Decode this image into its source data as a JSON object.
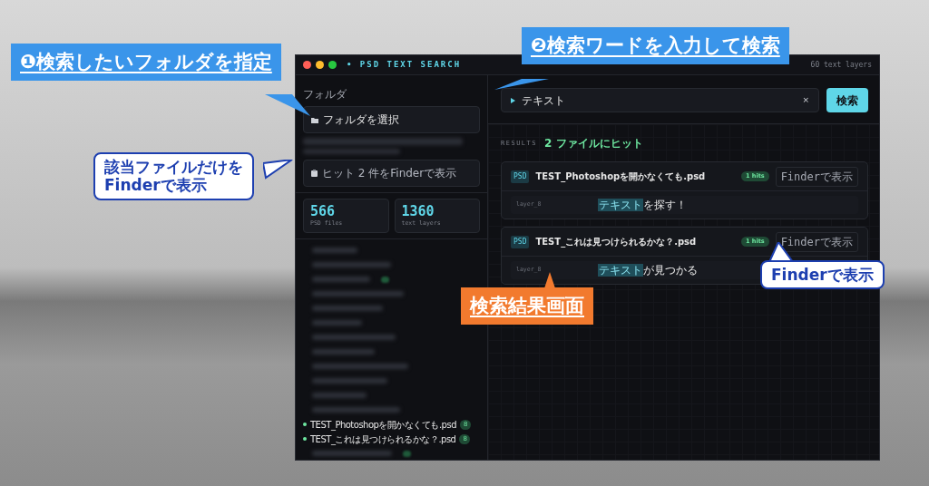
{
  "window": {
    "title": "• PSD TEXT SEARCH",
    "header_info": "60 text layers"
  },
  "sidebar": {
    "folder_label": "フォルダ",
    "folder_button": "フォルダを選択",
    "finder_button": "ヒット 2 件をFinderで表示",
    "stats": [
      {
        "value": "566",
        "label": "PSD files"
      },
      {
        "value": "1360",
        "label": "text layers"
      }
    ],
    "files": [
      {
        "kind": "blurred",
        "badge": false
      },
      {
        "kind": "blurred",
        "badge": false
      },
      {
        "kind": "blurred",
        "badge": true
      },
      {
        "kind": "blurred",
        "badge": false
      },
      {
        "kind": "blurred",
        "badge": false
      },
      {
        "kind": "blurred",
        "badge": false
      },
      {
        "kind": "blurred",
        "badge": false
      },
      {
        "kind": "blurred",
        "badge": false
      },
      {
        "kind": "blurred",
        "badge": false
      },
      {
        "kind": "blurred",
        "badge": false
      },
      {
        "kind": "blurred",
        "badge": false
      },
      {
        "kind": "blurred",
        "badge": false
      },
      {
        "kind": "file",
        "name": "TEST_Photoshopを開かなくても.psd",
        "count": "8"
      },
      {
        "kind": "file",
        "name": "TEST_これは見つけられるかな？.psd",
        "count": "8"
      },
      {
        "kind": "blurred",
        "badge": true
      }
    ]
  },
  "search": {
    "value": "テキスト",
    "clear": "×",
    "button": "検索"
  },
  "results": {
    "label": "RESULTS",
    "summary": "2 ファイルにヒット",
    "files": [
      {
        "tag": "PSD",
        "name": "TEST_Photoshopを開かなくても.psd",
        "hits": "1 hits",
        "finder_button": "Finderで表示",
        "matches": [
          {
            "layer": "layer_8",
            "highlight": "テキスト",
            "rest": "を探す！"
          }
        ]
      },
      {
        "tag": "PSD",
        "name": "TEST_これは見つけられるかな？.psd",
        "hits": "1 hits",
        "finder_button": "Finderで表示",
        "matches": [
          {
            "layer": "layer_8",
            "highlight": "テキスト",
            "rest": "が見つかる"
          }
        ]
      }
    ]
  },
  "callouts": [
    {
      "kind": "banner",
      "text": "❶検索したいフォルダを指定"
    },
    {
      "kind": "banner",
      "text": "❷検索ワードを入力して検索"
    },
    {
      "kind": "outline",
      "text": "該当ファイルだけを\nFinderで表示"
    },
    {
      "kind": "orange",
      "text": "検索結果画面"
    },
    {
      "kind": "outline",
      "text": "Finderで表示"
    }
  ]
}
